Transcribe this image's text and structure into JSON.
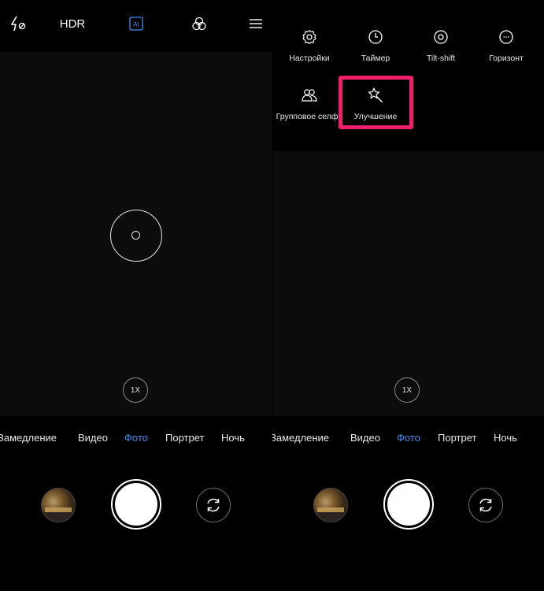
{
  "left_screen": {
    "topbar": {
      "hdr_label": "HDR",
      "ai_label": "AI"
    },
    "zoom_label": "1X",
    "modes": [
      {
        "label": "Замедление",
        "active": false
      },
      {
        "label": "Видео",
        "active": false
      },
      {
        "label": "Фото",
        "active": true
      },
      {
        "label": "Портрет",
        "active": false
      },
      {
        "label": "Ночь",
        "active": false
      }
    ]
  },
  "right_screen": {
    "settings_menu": {
      "items": [
        {
          "label": "Настройки",
          "icon": "gear-icon"
        },
        {
          "label": "Таймер",
          "icon": "timer-icon"
        },
        {
          "label": "Tilt-shift",
          "icon": "tilt-shift-icon"
        },
        {
          "label": "Горизонт",
          "icon": "horizon-icon"
        },
        {
          "label": "Групповое селфи",
          "icon": "group-selfie-icon"
        },
        {
          "label": "Улучшение",
          "icon": "beauty-wand-icon"
        }
      ],
      "highlighted_item": "Улучшение",
      "highlight_color": "#ef1f6b"
    },
    "zoom_label": "1X",
    "modes": [
      {
        "label": "Замедление",
        "active": false
      },
      {
        "label": "Видео",
        "active": false
      },
      {
        "label": "Фото",
        "active": true
      },
      {
        "label": "Портрет",
        "active": false
      },
      {
        "label": "Ночь",
        "active": false
      }
    ]
  },
  "colors": {
    "active_mode": "#3d8ef6",
    "background": "#000000",
    "viewfinder": "#0d0c0d"
  }
}
